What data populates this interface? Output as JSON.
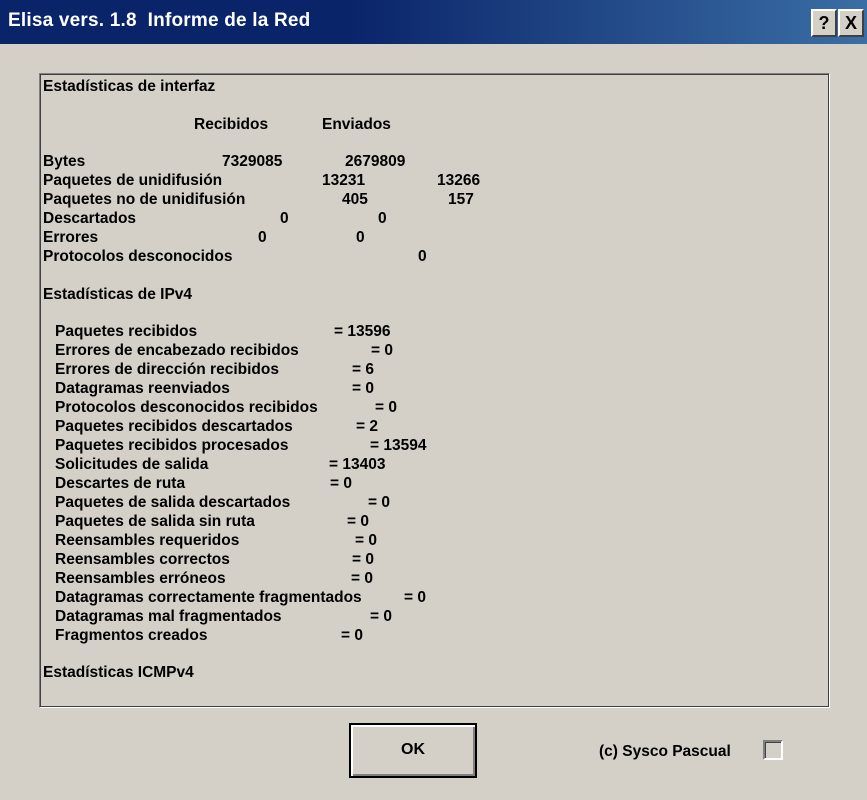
{
  "window": {
    "title": "Elisa vers. 1.8  Informe de la Red",
    "help_label": "?",
    "close_label": "X"
  },
  "interface": {
    "heading": "Estadísticas de interfaz",
    "col_received": "Recibidos",
    "col_sent": "Enviados",
    "rows": [
      {
        "label": "Bytes",
        "received": "7329085",
        "sent": "2679809"
      },
      {
        "label": "Paquetes de unidifusión",
        "received": "13231",
        "sent": "13266"
      },
      {
        "label": "Paquetes no de unidifusión",
        "received": "405",
        "sent": "157"
      },
      {
        "label": "Descartados",
        "received": "0",
        "sent": "0"
      },
      {
        "label": "Errores",
        "received": "0",
        "sent": "0"
      },
      {
        "label": "Protocolos desconocidos",
        "received": "0"
      }
    ]
  },
  "ipv4": {
    "heading": "Estadísticas de IPv4",
    "rows": [
      {
        "label": "Paquetes recibidos",
        "value": "= 13596"
      },
      {
        "label": "Errores de encabezado recibidos",
        "value": "= 0"
      },
      {
        "label": "Errores de dirección recibidos",
        "value": "= 6"
      },
      {
        "label": "Datagramas reenviados",
        "value": "= 0"
      },
      {
        "label": "Protocolos desconocidos recibidos",
        "value": "= 0"
      },
      {
        "label": "Paquetes recibidos descartados",
        "value": "= 2"
      },
      {
        "label": "Paquetes recibidos procesados",
        "value": "= 13594"
      },
      {
        "label": "Solicitudes de salida",
        "value": "= 13403"
      },
      {
        "label": "Descartes de ruta",
        "value": "= 0"
      },
      {
        "label": "Paquetes de salida descartados",
        "value": "= 0"
      },
      {
        "label": "Paquetes de salida sin ruta",
        "value": "= 0"
      },
      {
        "label": "Reensambles requeridos",
        "value": "= 0"
      },
      {
        "label": "Reensambles correctos",
        "value": "= 0"
      },
      {
        "label": "Reensambles erróneos",
        "value": "= 0"
      },
      {
        "label": "Datagramas correctamente fragmentados",
        "value": "= 0"
      },
      {
        "label": "Datagramas mal fragmentados",
        "value": "= 0"
      },
      {
        "label": "Fragmentos creados",
        "value": "= 0"
      }
    ]
  },
  "icmp": {
    "heading": "Estadísticas ICMPv4"
  },
  "footer": {
    "ok_label": "OK",
    "copyright": "(c) Sysco Pascual"
  }
}
